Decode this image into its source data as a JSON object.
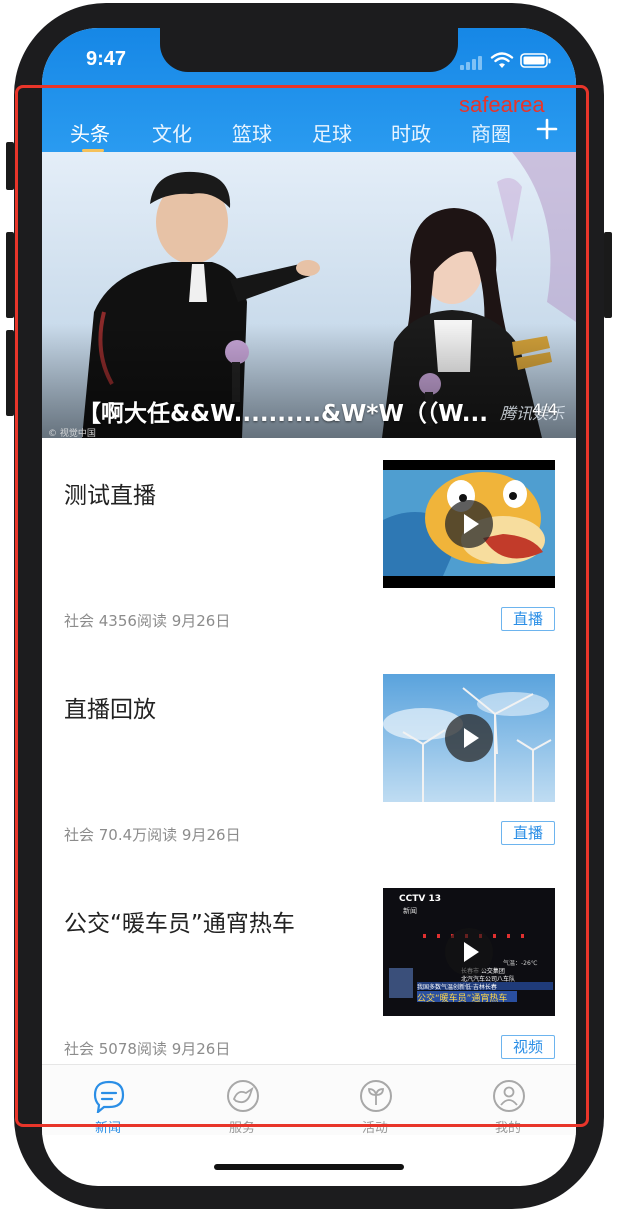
{
  "status_bar": {
    "time": "9:47"
  },
  "tabs": [
    {
      "label": "头条",
      "active": true
    },
    {
      "label": "文化"
    },
    {
      "label": "篮球"
    },
    {
      "label": "足球"
    },
    {
      "label": "时政"
    },
    {
      "label": "商圈"
    }
  ],
  "hero": {
    "caption": "【啊大任&&W..........&W*W（（W...",
    "counter": "4/4",
    "watermark": "腾讯娱乐",
    "credit": "© 视觉中国"
  },
  "news": [
    {
      "title": "测试直播",
      "meta": "社会   4356阅读   9月26日",
      "tag": "直播",
      "thumb": "cartoon-duck-video-thumbnail"
    },
    {
      "title": "直播回放",
      "meta": "社会   70.4万阅读   9月26日",
      "tag": "直播",
      "thumb": "wind-turbines-video-thumbnail"
    },
    {
      "title": "公交“暖车员”通宵热车",
      "meta": "社会   5078阅读   9月26日",
      "tag": "视频",
      "thumb": "cctv-news-video-thumbnail",
      "thumb_text": {
        "channel": "CCTV 13",
        "channel_sub": "新闻",
        "ticker1": "长春市 公交集团",
        "ticker2": "北汽汽车公司八车队",
        "ticker3": "我国多数气温创新低·吉林长春",
        "headline": "公交“暖车员”通宵热车",
        "temp": "气温：-26℃"
      }
    }
  ],
  "tabbar": [
    {
      "label": "新闻",
      "icon": "news-chat-icon",
      "active": true
    },
    {
      "label": "服务",
      "icon": "bird-icon"
    },
    {
      "label": "活动",
      "icon": "sprout-icon"
    },
    {
      "label": "我的",
      "icon": "person-icon"
    }
  ],
  "overlay": {
    "safearea_label": "safearea"
  },
  "colors": {
    "accent": "#2a8ee6",
    "header": "#1687e6",
    "safearea": "#e8352a",
    "indicator": "#f5c15b"
  }
}
